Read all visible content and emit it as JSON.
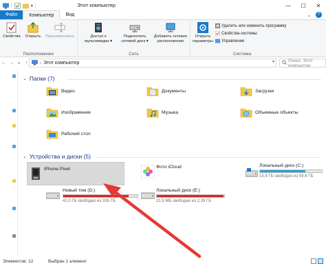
{
  "window": {
    "title": "Этот компьютер",
    "min_glyph": "—",
    "max_glyph": "☐",
    "close_glyph": "✕"
  },
  "tabs": [
    {
      "label": "Файл"
    },
    {
      "label": "Компьютер"
    },
    {
      "label": "Вид"
    }
  ],
  "ribbon": {
    "location": {
      "label": "Расположение",
      "properties": "Свойства",
      "open": "Открыть",
      "rename": "Переименовать"
    },
    "network": {
      "label": "Сеть",
      "media_access_l1": "Доступ к",
      "media_access_l2": "мультимедиа ▾",
      "map_drive_l1": "Подключить",
      "map_drive_l2": "сетевой диск ▾",
      "add_location_l1": "Добавить сетевое",
      "add_location_l2": "расположение"
    },
    "system": {
      "label": "Система",
      "open_settings_l1": "Открыть",
      "open_settings_l2": "параметры",
      "uninstall": "Удалить или изменить программу",
      "system_properties": "Свойства системы",
      "manage": "Управление"
    }
  },
  "address": {
    "path": "Этот компьютер",
    "search_placeholder": "Поиск: Этот компьютер"
  },
  "folders_section": {
    "header": "Папки (7)",
    "items": [
      {
        "label": "Видео"
      },
      {
        "label": "Документы"
      },
      {
        "label": "Загрузки"
      },
      {
        "label": "Изображения"
      },
      {
        "label": "Музыка"
      },
      {
        "label": "Объемные объекты"
      },
      {
        "label": "Рабочий стол"
      }
    ]
  },
  "devices_section": {
    "header": "Устройства и диски (5)",
    "items": [
      {
        "name": "iPhone Pixel",
        "selected": true
      },
      {
        "name": "Фото iCloud"
      },
      {
        "name": "Локальный диск (C:)",
        "free": "15,9 ГБ свободно из 59,6 ГБ",
        "used_fraction": 0.73,
        "fill_color": "#26a0da"
      },
      {
        "name": "Новый том (D:)",
        "free": "41,0 ГБ свободно из 335 ГБ",
        "used_fraction": 0.88,
        "fill_color": "#da2626"
      },
      {
        "name": "Локальный диск (E:)",
        "free": "21,5 МБ свободно из 2,39 ГБ",
        "used_fraction": 0.99,
        "fill_color": "#da2626"
      }
    ]
  },
  "status": {
    "count": "Элементов: 12",
    "selected": "Выбран 1 элемент"
  },
  "colors": {
    "accent": "#1979ca",
    "section_header": "#1e3287",
    "arrow": "#e53935"
  }
}
